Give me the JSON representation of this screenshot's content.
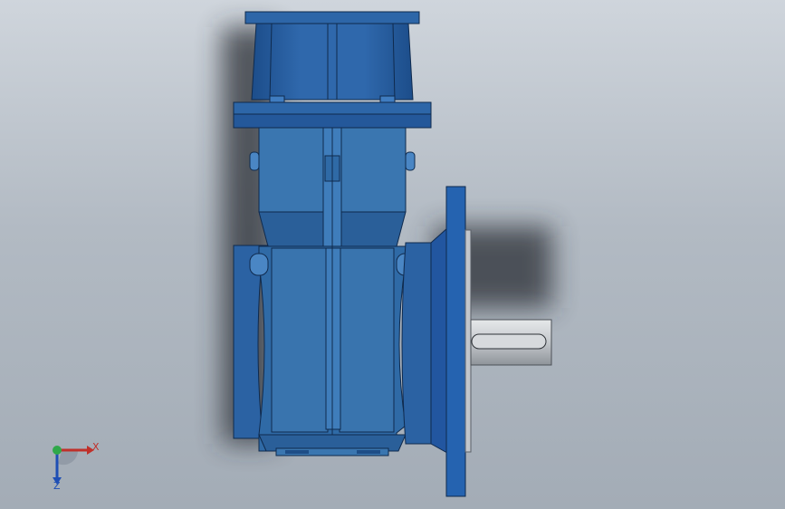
{
  "app": {
    "type": "CAD 3D model viewport"
  },
  "model": {
    "name": "gearbox-reducer",
    "body_color": "#2f6aa6",
    "body_dark": "#1f4f86",
    "shaft_color": "#c9ccd1"
  },
  "triad": {
    "x_label": "X",
    "z_label": "Z",
    "x_color": "#c0302a",
    "y_color": "#2fa84a",
    "z_color": "#1f4fb5"
  },
  "background": {
    "top": "#cfd5dc",
    "bottom": "#a3acb6"
  }
}
